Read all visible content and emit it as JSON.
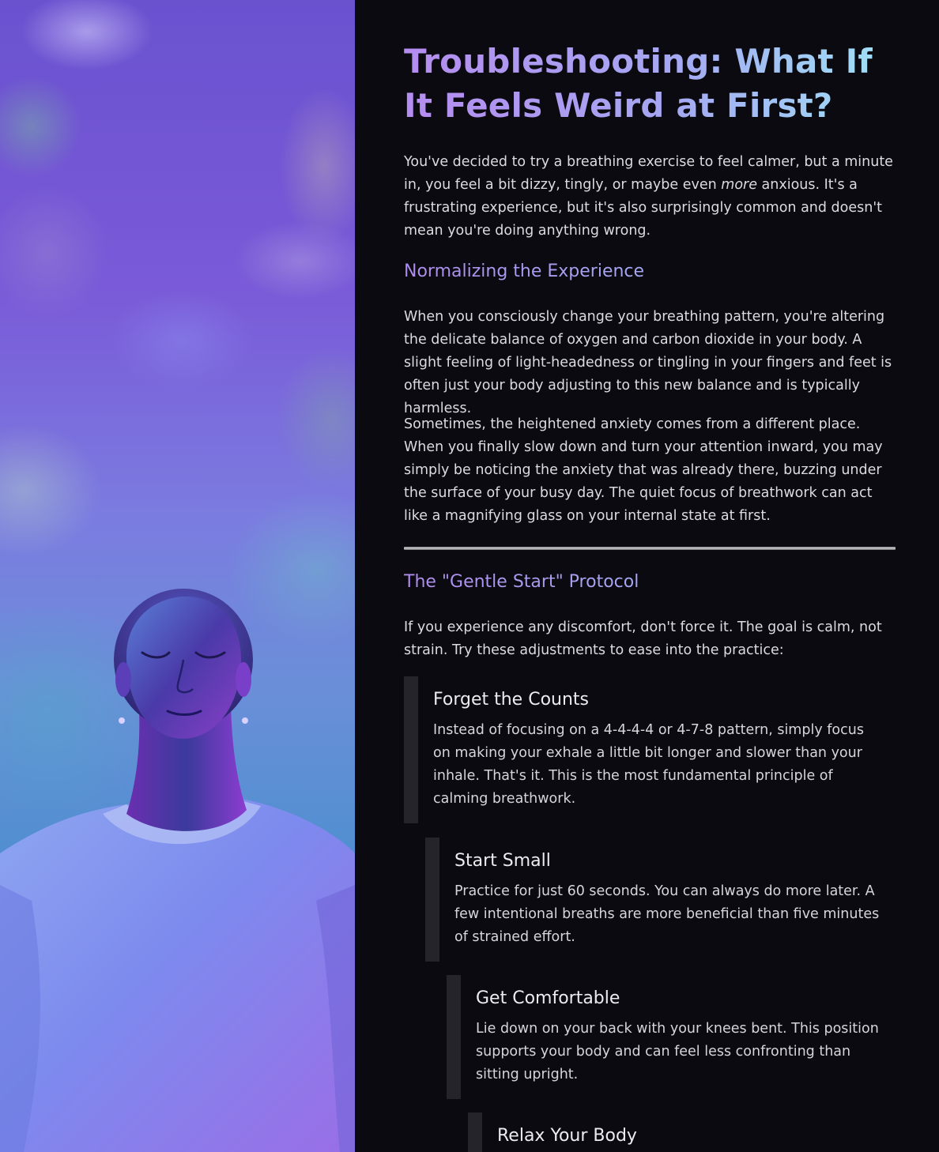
{
  "hero": {
    "image_alt": "Person with closed eyes breathing calmly under a purple sky"
  },
  "article": {
    "title": "Troubleshooting: What If It Feels Weird at First?",
    "intro_before": "You've decided to try a breathing exercise to feel calmer, but a minute in, you feel a bit dizzy, tingly, or maybe even ",
    "intro_em": "more",
    "intro_after": " anxious. It's a frustrating experience, but it's also surprisingly common and doesn't mean you're doing anything wrong.",
    "section1": {
      "heading": "Normalizing the Experience",
      "p1": "When you consciously change your breathing pattern, you're altering the delicate balance of oxygen and carbon dioxide in your body. A slight feeling of light-headedness or tingling in your fingers and feet is often just your body adjusting to this new balance and is typically harmless.",
      "p2": "Sometimes, the heightened anxiety comes from a different place. When you finally slow down and turn your attention inward, you may simply be noticing the anxiety that was already there, buzzing under the surface of your busy day. The quiet focus of breathwork can act like a magnifying glass on your internal state at first."
    },
    "section2": {
      "heading": "The \"Gentle Start\" Protocol",
      "intro": "If you experience any discomfort, don't force it. The goal is calm, not strain. Try these adjustments to ease into the practice:",
      "steps": [
        {
          "title": "Forget the Counts",
          "body": "Instead of focusing on a 4-4-4-4 or 4-7-8 pattern, simply focus on making your exhale a little bit longer and slower than your inhale. That's it. This is the most fundamental principle of calming breathwork."
        },
        {
          "title": "Start Small",
          "body": "Practice for just 60 seconds. You can always do more later. A few intentional breaths are more beneficial than five minutes of strained effort."
        },
        {
          "title": "Get Comfortable",
          "body": "Lie down on your back with your knees bent. This position supports your body and can feel less confronting than sitting upright."
        },
        {
          "title": "Relax Your Body",
          "body": ""
        }
      ]
    }
  }
}
